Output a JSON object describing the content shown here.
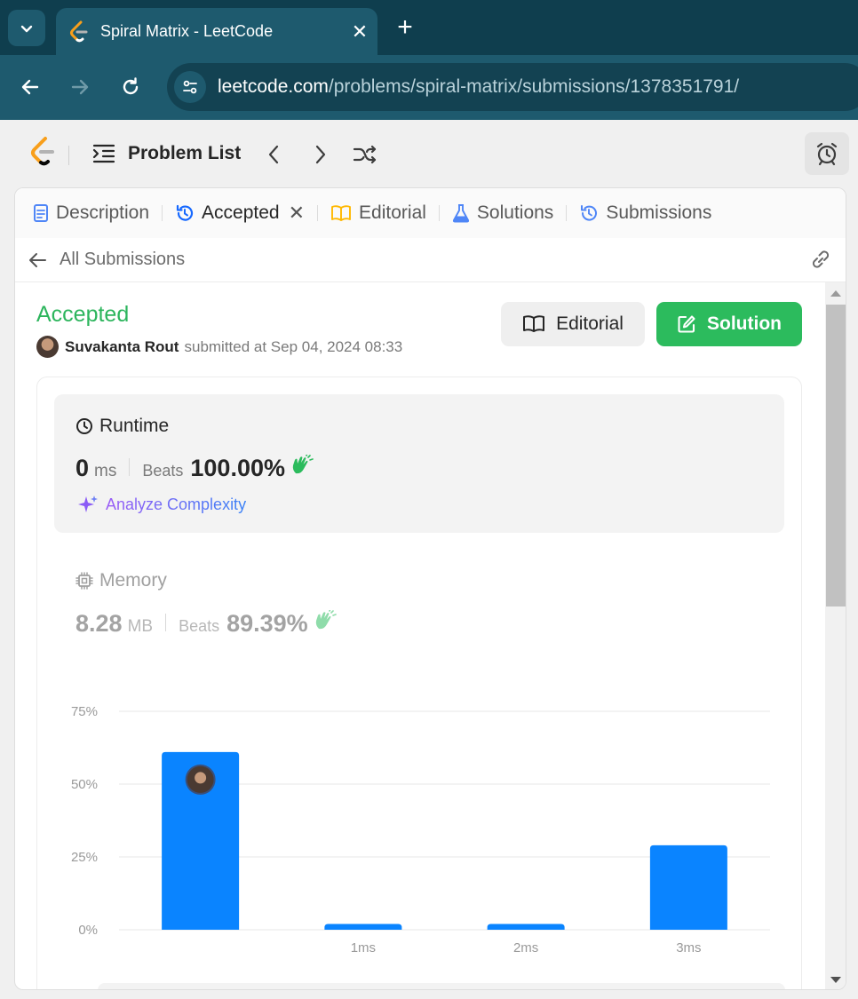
{
  "browser": {
    "tab_title": "Spiral Matrix - LeetCode",
    "tab_close": "✕",
    "new_tab": "+",
    "url_host": "leetcode.com",
    "url_path": "/problems/spiral-matrix/submissions/1378351791/"
  },
  "lc_nav": {
    "problem_list_label": "Problem List"
  },
  "panel_tabs": [
    {
      "label": "Description"
    },
    {
      "label": "Accepted",
      "close": "✕"
    },
    {
      "label": "Editorial"
    },
    {
      "label": "Solutions"
    },
    {
      "label": "Submissions"
    }
  ],
  "subbar": {
    "back_label": "All Submissions"
  },
  "submission": {
    "status": "Accepted",
    "user": "Suvakanta Rout",
    "submitted_text": "submitted at Sep 04, 2024 08:33",
    "editorial_button": "Editorial",
    "solution_button": "Solution"
  },
  "runtime": {
    "label": "Runtime",
    "value": "0",
    "unit": "ms",
    "beats_label": "Beats",
    "beats_pct": "100.00%",
    "analyze_label": "Analyze Complexity"
  },
  "memory": {
    "label": "Memory",
    "value": "8.28",
    "unit": "MB",
    "beats_label": "Beats",
    "beats_pct": "89.39%"
  },
  "colors": {
    "accepted": "#2db55d",
    "bar": "#0a84ff",
    "solution_btn": "#2cbb5d"
  },
  "chart_data": {
    "type": "bar",
    "categories": [
      "",
      "1ms",
      "2ms",
      "3ms"
    ],
    "values": [
      61,
      2,
      2,
      29
    ],
    "ylim": [
      0,
      75
    ],
    "yticks": [
      "0%",
      "25%",
      "50%",
      "75%"
    ],
    "ytick_values": [
      0,
      25,
      50,
      75
    ],
    "grid": true,
    "highlight_index": 0
  }
}
